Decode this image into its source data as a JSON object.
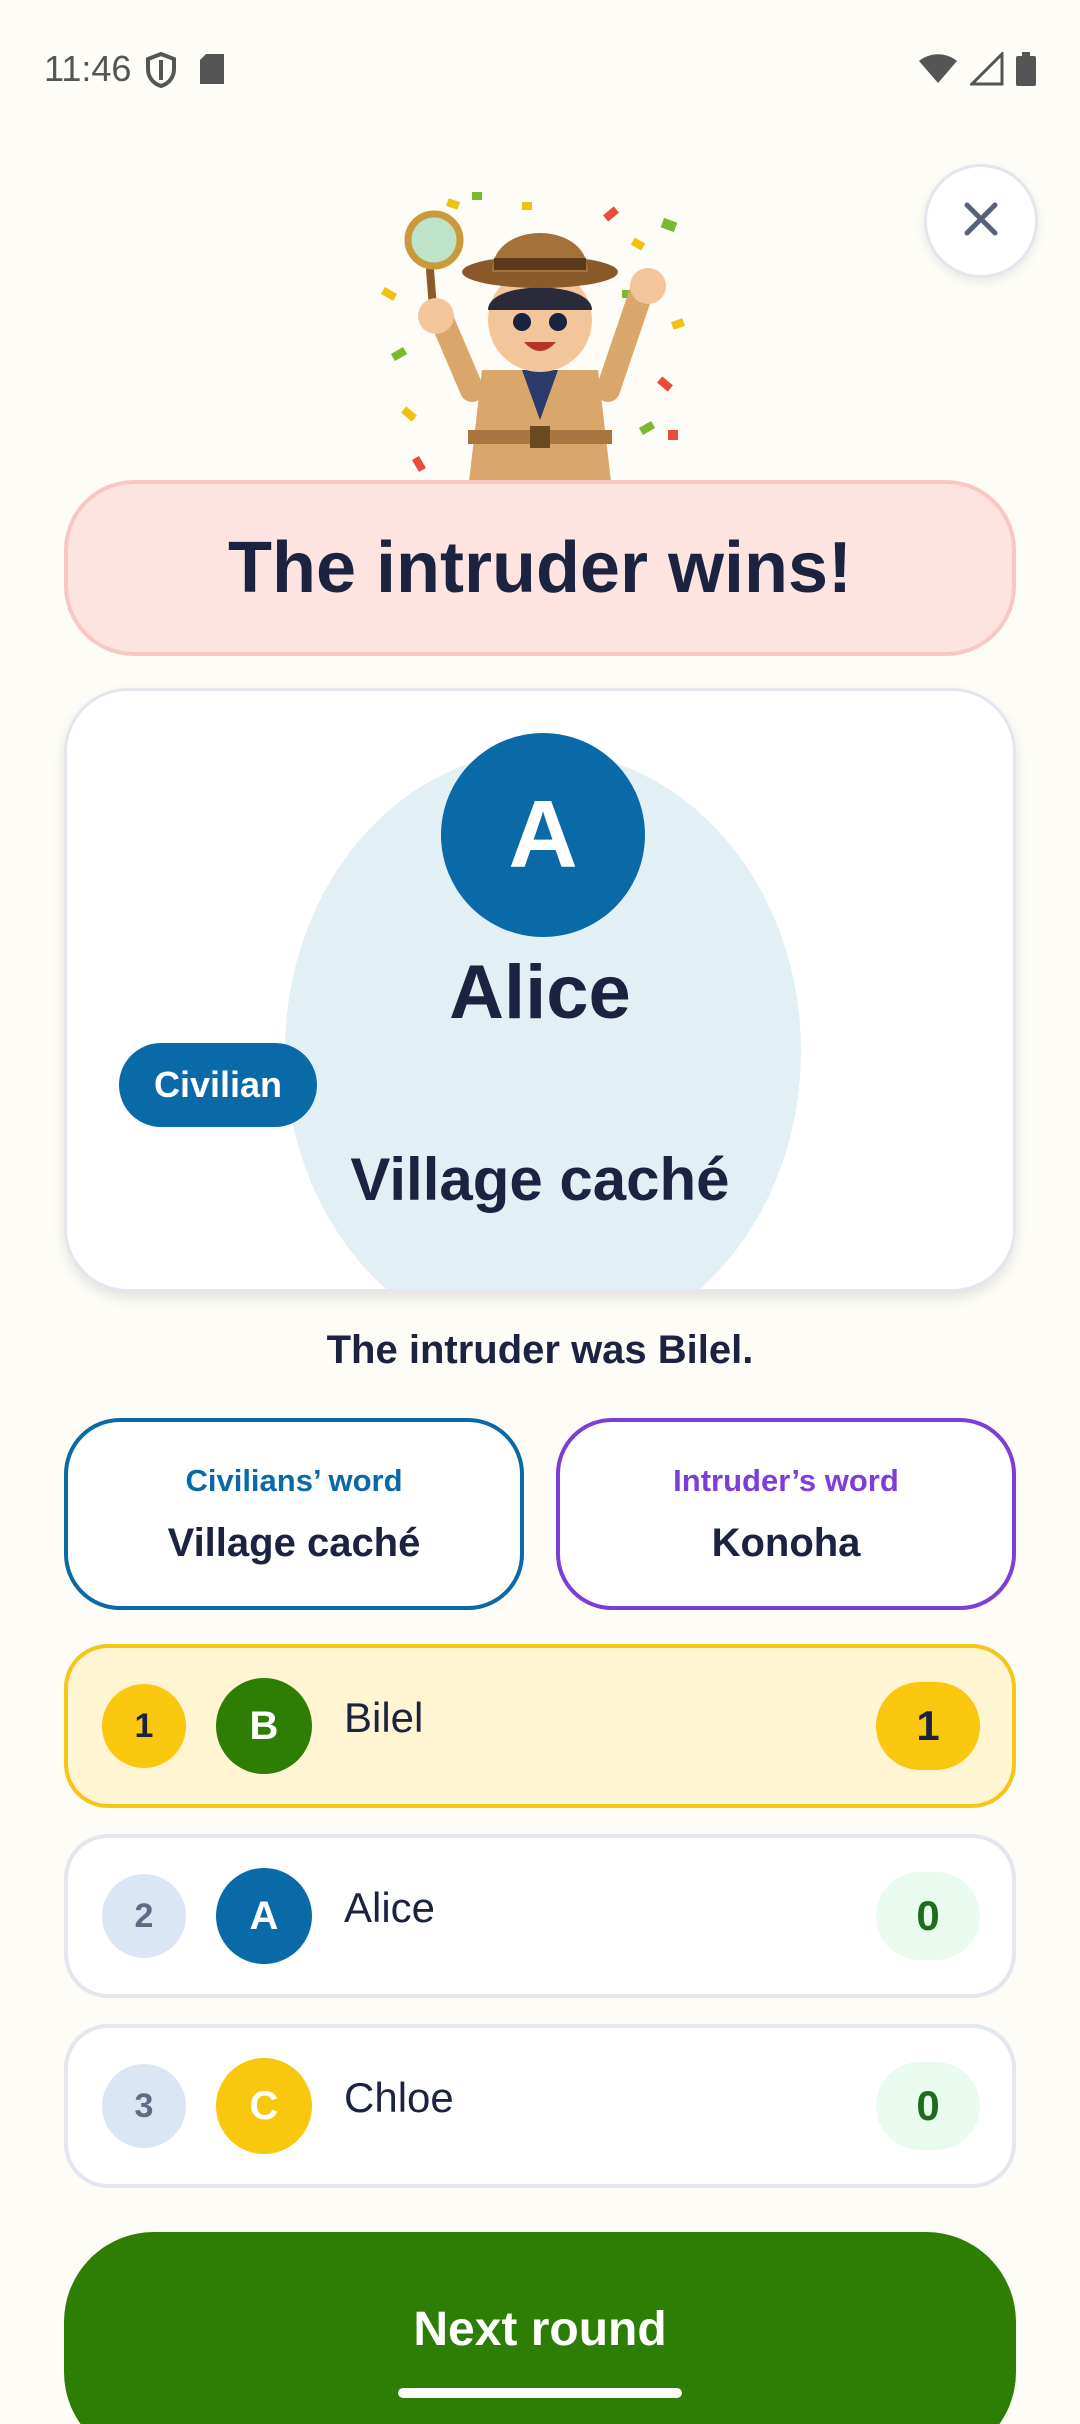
{
  "status": {
    "time": "11:46"
  },
  "result": {
    "title": "The intruder wins!"
  },
  "reveal": {
    "initial": "A",
    "name": "Alice",
    "role": "Civilian",
    "word": "Village caché"
  },
  "intruder_text": "The intruder was Bilel.",
  "words": {
    "civilians_label": "Civilians’ word",
    "civilians_word": "Village caché",
    "intruder_label": "Intruder’s word",
    "intruder_word": "Konoha"
  },
  "scoreboard": [
    {
      "rank": "1",
      "initial": "B",
      "name": "Bilel",
      "score": "1",
      "avatar_color": "#2e7d05"
    },
    {
      "rank": "2",
      "initial": "A",
      "name": "Alice",
      "score": "0",
      "avatar_color": "#0a6aa8"
    },
    {
      "rank": "3",
      "initial": "C",
      "name": "Chloe",
      "score": "0",
      "avatar_color": "#f9c80e"
    }
  ],
  "next_button": "Next round",
  "icons": {
    "close": "close-icon",
    "mascot": "detective-mascot-illustration"
  },
  "colors": {
    "primary_blue": "#0a6aa8",
    "intruder_purple": "#7c3ed6",
    "green": "#2e7d05",
    "gold": "#f9c80e",
    "banner_pink": "#fde4e1"
  }
}
